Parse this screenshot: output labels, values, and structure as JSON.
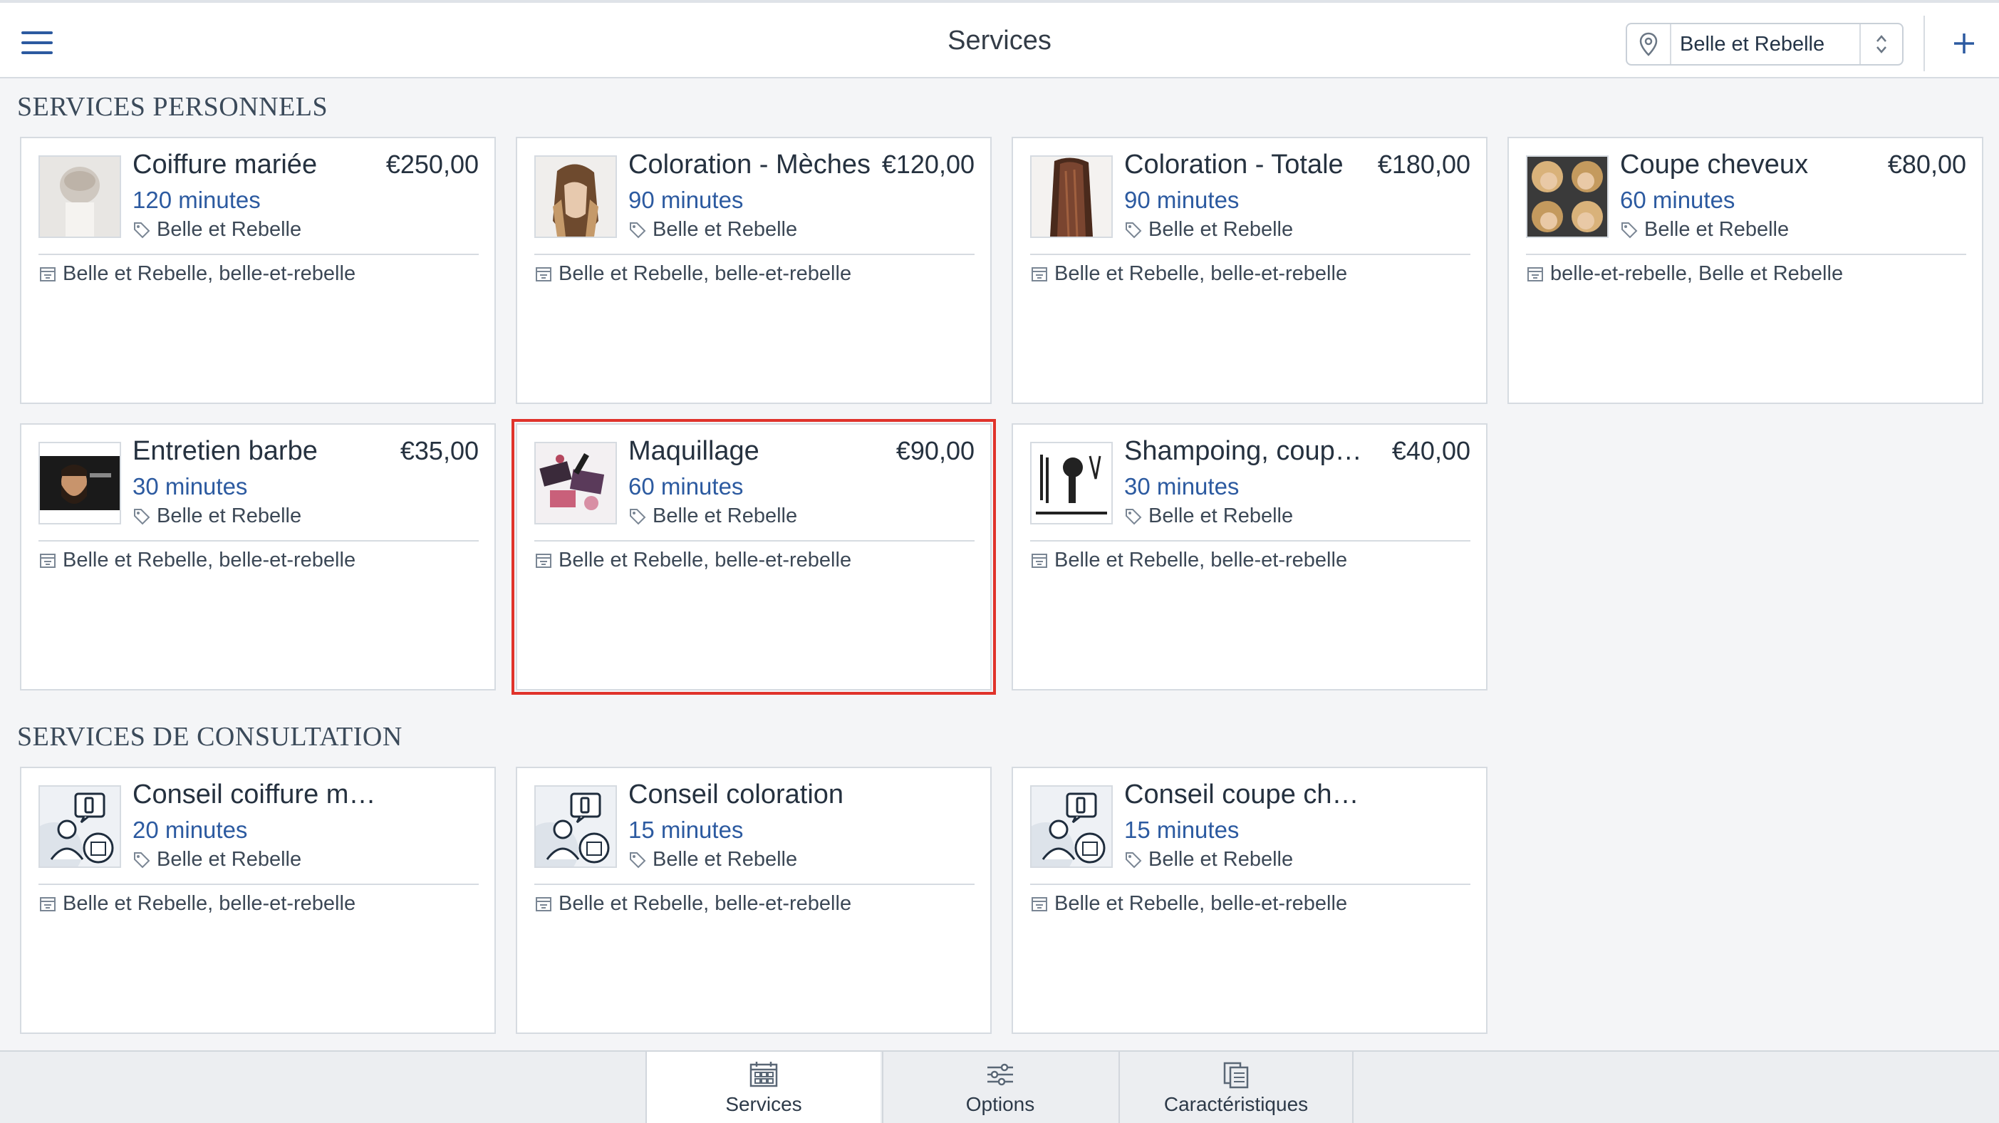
{
  "header": {
    "title": "Services",
    "location": "Belle et Rebelle"
  },
  "sections": {
    "personal": {
      "title": "SERVICES PERSONNELS",
      "cards": [
        {
          "name": "Coiffure mariée",
          "price": "€250,00",
          "duration": "120 minutes",
          "location": "Belle et Rebelle",
          "resources": "Belle et Rebelle, belle-et-rebelle"
        },
        {
          "name": "Coloration - Mèches",
          "price": "€120,00",
          "duration": "90 minutes",
          "location": "Belle et Rebelle",
          "resources": "Belle et Rebelle, belle-et-rebelle"
        },
        {
          "name": "Coloration - Totale",
          "price": "€180,00",
          "duration": "90 minutes",
          "location": "Belle et Rebelle",
          "resources": "Belle et Rebelle, belle-et-rebelle"
        },
        {
          "name": "Coupe cheveux",
          "price": "€80,00",
          "duration": "60 minutes",
          "location": "Belle et Rebelle",
          "resources": "belle-et-rebelle, Belle et Rebelle"
        },
        {
          "name": "Entretien barbe",
          "price": "€35,00",
          "duration": "30 minutes",
          "location": "Belle et Rebelle",
          "resources": "Belle et Rebelle, belle-et-rebelle"
        },
        {
          "name": "Maquillage",
          "price": "€90,00",
          "duration": "60 minutes",
          "location": "Belle et Rebelle",
          "resources": "Belle et Rebelle, belle-et-rebelle"
        },
        {
          "name": "Shampoing, coupe, ...",
          "price": "€40,00",
          "duration": "30 minutes",
          "location": "Belle et Rebelle",
          "resources": "Belle et Rebelle, belle-et-rebelle"
        }
      ]
    },
    "consultation": {
      "title": "SERVICES DE CONSULTATION",
      "cards": [
        {
          "name": "Conseil coiffure mariée",
          "price": "",
          "duration": "20 minutes",
          "location": "Belle et Rebelle",
          "resources": "Belle et Rebelle, belle-et-rebelle"
        },
        {
          "name": "Conseil coloration",
          "price": "",
          "duration": "15 minutes",
          "location": "Belle et Rebelle",
          "resources": "Belle et Rebelle, belle-et-rebelle"
        },
        {
          "name": "Conseil coupe cheveux",
          "price": "",
          "duration": "15 minutes",
          "location": "Belle et Rebelle",
          "resources": "Belle et Rebelle, belle-et-rebelle"
        }
      ]
    }
  },
  "tabs": [
    {
      "label": "Services",
      "icon": "calendar-grid-icon",
      "active": true
    },
    {
      "label": "Options",
      "icon": "sliders-icon",
      "active": false
    },
    {
      "label": "Caractéristiques",
      "icon": "clipboard-list-icon",
      "active": false
    }
  ],
  "colors": {
    "accent": "#2c5aa0",
    "selection": "#e0332b"
  }
}
